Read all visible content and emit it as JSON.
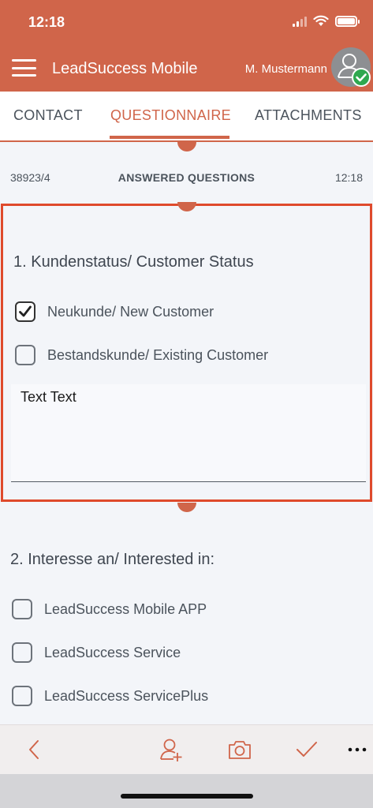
{
  "status_bar": {
    "time": "12:18"
  },
  "header": {
    "app_title": "LeadSuccess Mobile",
    "user_name": "M. Mustermann",
    "accent_color": "#d0654a"
  },
  "tabs": [
    {
      "label": "CONTACT",
      "active": false
    },
    {
      "label": "QUESTIONNAIRE",
      "active": true
    },
    {
      "label": "ATTACHMENTS",
      "active": false
    }
  ],
  "info": {
    "id": "38923/4",
    "title": "ANSWERED QUESTIONS",
    "time": "12:18"
  },
  "questions": [
    {
      "title": "1. Kundenstatus/ Customer Status",
      "options": [
        {
          "label": "Neukunde/ New Customer",
          "checked": true
        },
        {
          "label": "Bestandskunde/ Existing Customer",
          "checked": false
        }
      ],
      "text_value": "Text Text"
    },
    {
      "title": "2. Interesse an/ Interested in:",
      "options": [
        {
          "label": "LeadSuccess Mobile APP",
          "checked": false
        },
        {
          "label": "LeadSuccess Service",
          "checked": false
        },
        {
          "label": "LeadSuccess ServicePlus",
          "checked": false
        }
      ]
    }
  ],
  "bottom_bar": {
    "icons": [
      "back-arrow-icon",
      "add-contact-icon",
      "camera-icon",
      "checkmark-icon",
      "more-icon"
    ]
  }
}
